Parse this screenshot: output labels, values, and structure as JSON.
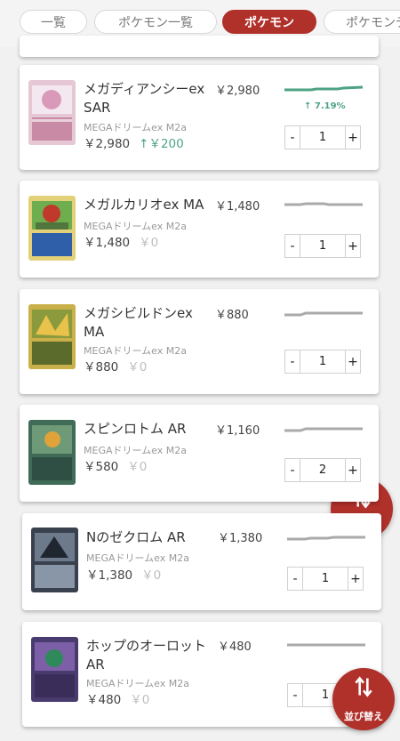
{
  "tabs": [
    {
      "label": "一覧"
    },
    {
      "label": "ポケモン一覧"
    },
    {
      "label": "ポケモン"
    },
    {
      "label": "ポケモンデ"
    }
  ],
  "cards": [
    {
      "name": "メガディアンシーex SAR",
      "set": "MEGAドリームex M2a",
      "owned_price": "￥2,980",
      "delta": "↑￥200",
      "market_price": "￥2,980",
      "trend_percent": "↑ 7.19%",
      "quantity": "1",
      "trend": "up"
    },
    {
      "name": "メガルカリオex MA",
      "set": "MEGAドリームex M2a",
      "owned_price": "￥1,480",
      "delta": "￥0",
      "market_price": "￥1,480",
      "quantity": "1",
      "trend": "flat"
    },
    {
      "name": "メガシビルドンex MA",
      "set": "MEGAドリームex M2a",
      "owned_price": "￥880",
      "delta": "￥0",
      "market_price": "￥880",
      "quantity": "1",
      "trend": "flat"
    },
    {
      "name": "スピンロトム AR",
      "set": "MEGAドリームex M2a",
      "owned_price": "￥580",
      "delta": "￥0",
      "market_price": "￥1,160",
      "quantity": "2",
      "trend": "flat"
    },
    {
      "name": "Nのゼクロム AR",
      "set": "MEGAドリームex M2a",
      "owned_price": "￥1,380",
      "delta": "￥0",
      "market_price": "￥1,380",
      "quantity": "1",
      "trend": "flat"
    },
    {
      "name": "ホップのオーロット AR",
      "set": "MEGAドリームex M2a",
      "owned_price": "￥480",
      "delta": "￥0",
      "market_price": "￥480",
      "quantity": "1",
      "trend": "flat"
    }
  ],
  "stepper": {
    "minus": "-",
    "plus": "+"
  },
  "sort_button": {
    "label": "並び替え"
  },
  "colors": {
    "accent": "#b0302a",
    "trend_up": "#4da383",
    "trend_flat": "#aaaaaa"
  }
}
